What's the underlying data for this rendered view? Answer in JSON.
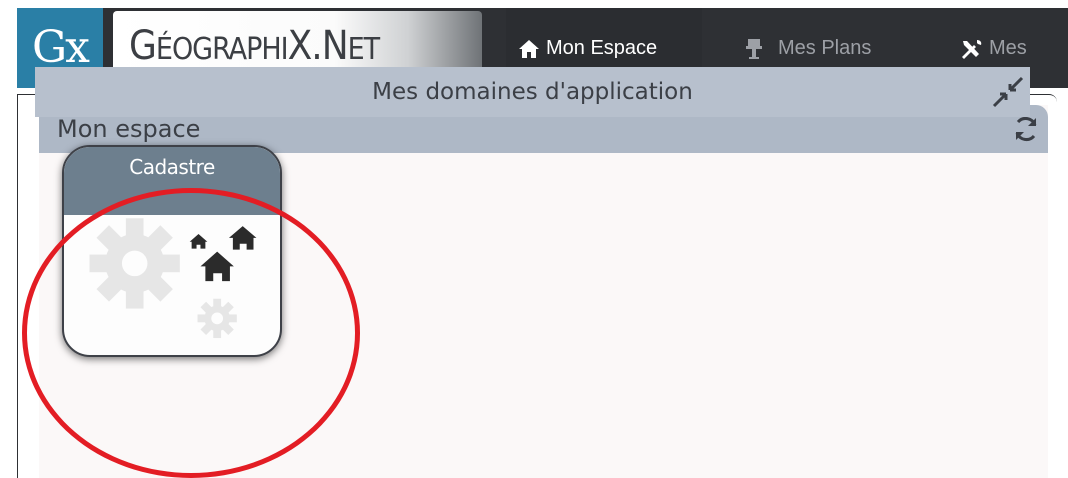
{
  "brand": {
    "logo_mark": "Gx",
    "name_parts": [
      "G",
      "ÉOGRAPHI",
      "X",
      ".N",
      "ET"
    ]
  },
  "nav": {
    "items": [
      {
        "label": "Mon Espace",
        "icon": "home-icon",
        "active": true
      },
      {
        "label": "Mes Plans",
        "icon": "plans-icon",
        "active": false
      },
      {
        "label": "Mes",
        "icon": "tools-icon",
        "active": false
      }
    ]
  },
  "panel": {
    "title": "Mon espace",
    "section_title": "Mes domaines d'application"
  },
  "tiles": [
    {
      "label": "Cadastre",
      "icon": "cadastre-icon"
    }
  ],
  "colors": {
    "topbar": "#2e3034",
    "logo_accent": "#2a7fa6",
    "panel_header": "#aeb8c6",
    "section_header": "#b7c0cd",
    "tile_header": "#6d7f8e",
    "annotation": "#e31d24"
  }
}
